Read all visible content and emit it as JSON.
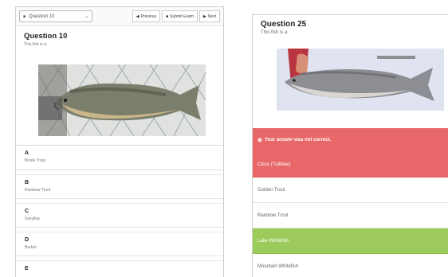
{
  "left": {
    "toolbar": {
      "question_select": "Question 10",
      "previous_label": "Previous",
      "submit_label": "Submit Exam",
      "next_label": "Next"
    },
    "question": {
      "title": "Question 10",
      "prompt": "This fish is a:"
    },
    "options": [
      {
        "letter": "A",
        "text": "Brook Trout"
      },
      {
        "letter": "B",
        "text": "Rainbow Trout"
      },
      {
        "letter": "C",
        "text": "Grayling"
      },
      {
        "letter": "D",
        "text": "Burbot"
      },
      {
        "letter": "E",
        "text": ""
      }
    ]
  },
  "right": {
    "question": {
      "title": "Question 25",
      "prompt": "This fish is a:"
    },
    "alert": {
      "text": "Your answer was not correct."
    },
    "answers": [
      {
        "text": "Cisco (Tullibee)",
        "state": "wrong"
      },
      {
        "text": "Golden Trout",
        "state": "neutral"
      },
      {
        "text": "Rainbow Trout",
        "state": "neutral"
      },
      {
        "text": "Lake Whitefish",
        "state": "correct"
      },
      {
        "text": "Mountain Whitefish",
        "state": "neutral"
      }
    ]
  },
  "colors": {
    "wrong": "#e8686a",
    "correct": "#9cca5b"
  },
  "icons": {
    "previous": "arrow-left-icon",
    "submit": "square-icon",
    "next": "arrow-right-icon",
    "alert": "circle-x-icon"
  }
}
